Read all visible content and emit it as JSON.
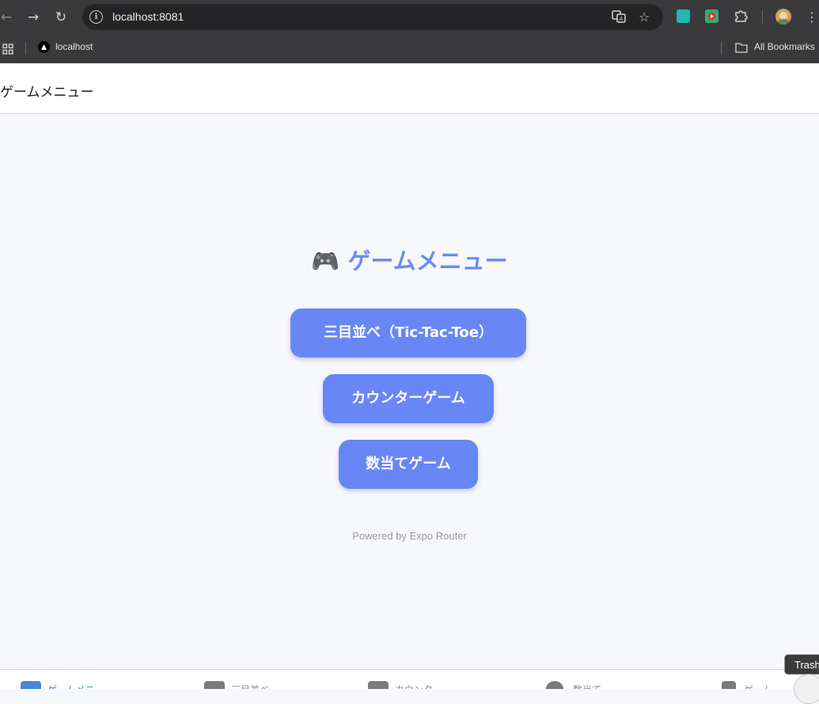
{
  "browser": {
    "url": "localhost:8081",
    "bookmark_label": "localhost",
    "all_bookmarks_label": "All Bookmarks"
  },
  "header": {
    "title": "ゲームメニュー"
  },
  "main": {
    "title_emoji": "🎮",
    "title": "ゲームメニュー",
    "buttons": [
      {
        "label": "三目並べ（Tic-Tac-Toe）"
      },
      {
        "label": "カウンターゲーム"
      },
      {
        "label": "数当てゲーム"
      }
    ],
    "footer": "Powered by Expo Router"
  },
  "tabs": [
    {
      "label": "ゲームメニ",
      "active": true
    },
    {
      "label": "三目並べ",
      "active": false
    },
    {
      "label": "カウンタ",
      "active": false
    },
    {
      "label": "数当て",
      "active": false
    },
    {
      "label": "ゲーム",
      "active": false
    }
  ],
  "tooltip": {
    "text": "Trash"
  },
  "colors": {
    "accent": "#6887f5",
    "title": "#6c8cf2",
    "chrome": "#3a3a3c",
    "background": "#f7f8fc"
  }
}
